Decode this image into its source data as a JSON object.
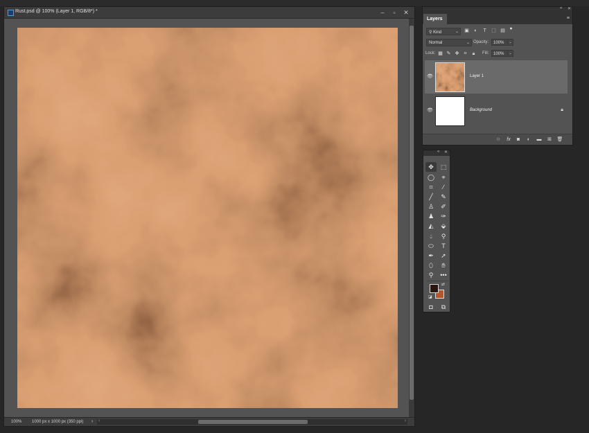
{
  "document": {
    "title": "Rust.psd @ 100% (Layer 1, RGB/8*) *",
    "controls": [
      "–",
      "▫",
      "✕"
    ],
    "zoom": "100%",
    "info": "1000 px x 1000 px (350 ppi)",
    "canvas": {
      "base_color": "#a9552a",
      "light_color": "#b65f31",
      "dark_color": "#5c2a14",
      "description_pattern": "rust clouds texture"
    }
  },
  "layers_panel": {
    "tab_label": "Layers",
    "menu_icon": "≡",
    "collapse_icon": "«",
    "close_icon": "✕",
    "filter_kind_label": "Kind",
    "blend_mode": "Normal",
    "opacity_label": "Opacity:",
    "opacity_value": "100%",
    "lock_label": "Lock:",
    "fill_label": "Fill:",
    "fill_value": "100%",
    "layers": [
      {
        "name": "Layer 1",
        "visible": true,
        "selected": true,
        "locked": false
      },
      {
        "name": "Background",
        "visible": true,
        "selected": false,
        "locked": true
      }
    ],
    "bottom_icons": [
      "link-icon",
      "fx-icon",
      "mask-icon",
      "adjustment-icon",
      "group-icon",
      "new-layer-icon",
      "trash-icon"
    ]
  },
  "tools_panel": {
    "collapse_icon": "«",
    "close_icon": "✕",
    "foreground_color": "#2a150f",
    "background_color": "#b4552a",
    "tools": [
      [
        "move-tool",
        "rectangular-marquee-tool"
      ],
      [
        "lasso-tool",
        "quick-selection-tool"
      ],
      [
        "crop-tool",
        "eyedropper-tool"
      ],
      [
        "healing-brush-tool",
        "brush-tool"
      ],
      [
        "clone-stamp-tool",
        "history-brush-tool"
      ],
      [
        "eraser-tool",
        "paint-bucket-tool"
      ],
      [
        "blur-tool",
        "dodge-tool"
      ],
      [
        "pen-tool",
        "type-tool"
      ],
      [
        "path-selection-tool",
        "rectangle-tool"
      ],
      [
        "hand-tool",
        "zoom-tool"
      ],
      [
        "edit-toolbar",
        "more-tools"
      ]
    ]
  }
}
